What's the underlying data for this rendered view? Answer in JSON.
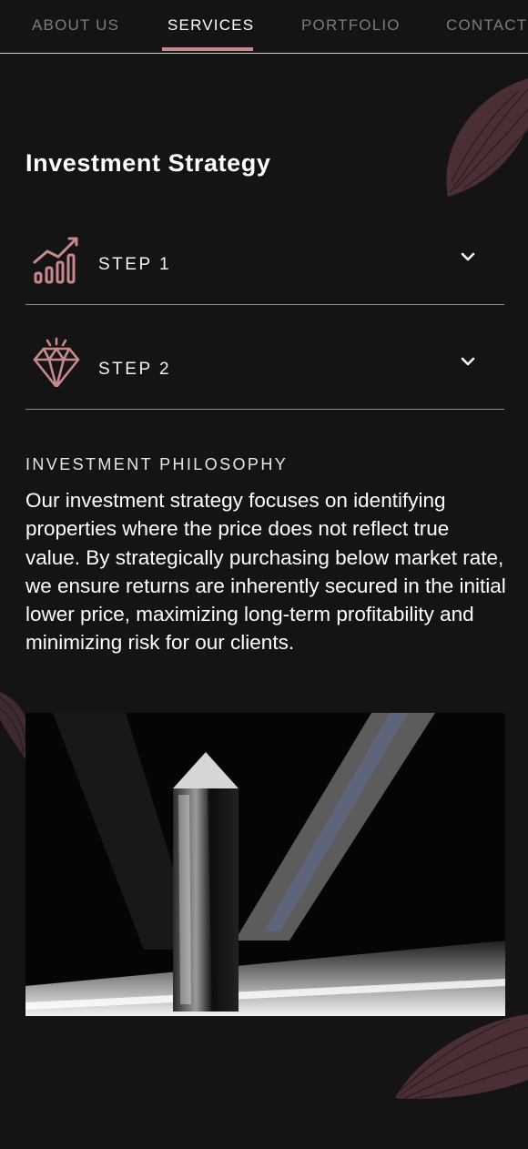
{
  "nav": {
    "items": [
      {
        "label": "ABOUT US"
      },
      {
        "label": "SERVICES"
      },
      {
        "label": "PORTFOLIO"
      },
      {
        "label": "CONTACT"
      }
    ],
    "active": "SERVICES"
  },
  "section": {
    "title": "Investment Strategy",
    "steps": [
      {
        "label": "STEP 1",
        "icon": "bar-chart-growth-icon",
        "expanded": false
      },
      {
        "label": "STEP 2",
        "icon": "diamond-icon",
        "expanded": false
      }
    ]
  },
  "philosophy": {
    "heading": "INVESTMENT PHILOSOPHY",
    "body": "Our investment strategy focuses on identifying properties where the price does not reflect true value. By strategically purchasing below market rate, we ensure returns are inherently secured in the initial lower price, maximizing long-term profitability and minimizing risk for our clients."
  },
  "colors": {
    "background": "#141415",
    "accent": "#c7898c",
    "leaf": "#5a3a40",
    "divider": "#8a8a8a"
  }
}
